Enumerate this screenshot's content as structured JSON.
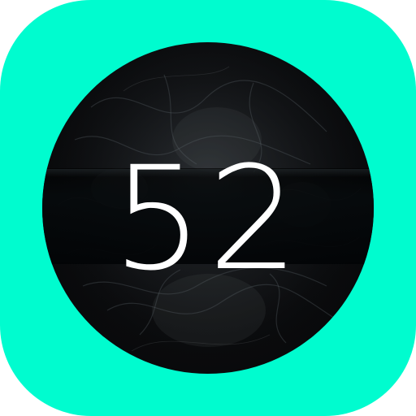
{
  "app_icon": {
    "name": "counter-app",
    "background_color": "#00fccf",
    "dial_color": "#0b0c0e"
  },
  "counter": {
    "value": "52"
  }
}
